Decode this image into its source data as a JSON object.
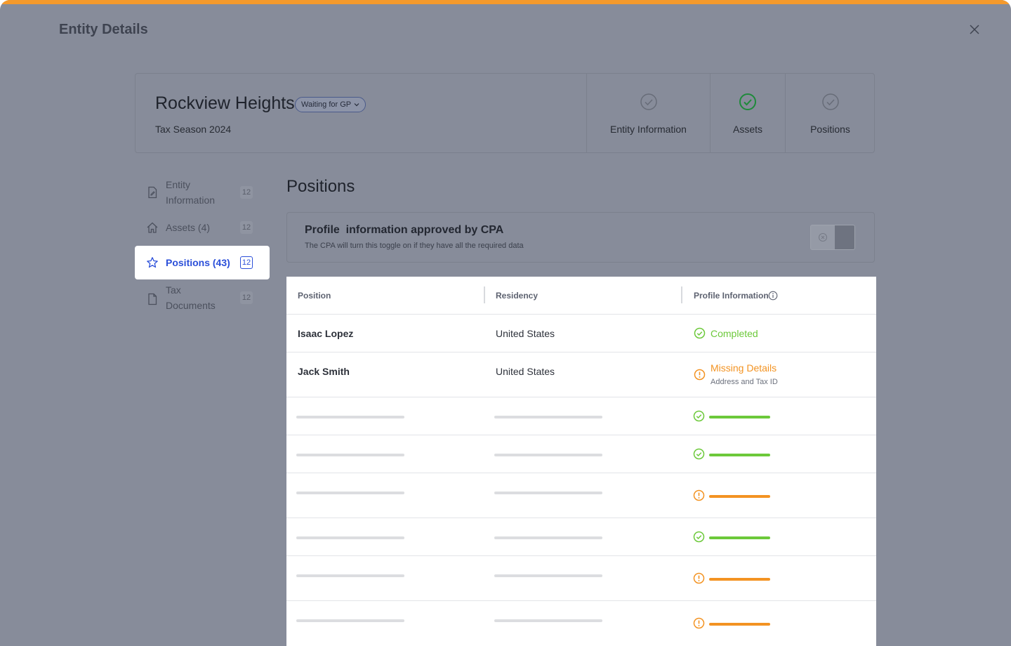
{
  "modal": {
    "title": "Entity Details"
  },
  "entity": {
    "name": "Rockview Heights",
    "status": "Waiting for GP",
    "subtitle": "Tax Season 2024"
  },
  "steps": [
    {
      "label": "Entity Information",
      "state": "pending",
      "icon": "check-circle-icon"
    },
    {
      "label": "Assets",
      "state": "done",
      "icon": "check-circle-icon"
    },
    {
      "label": "Positions",
      "state": "pending",
      "icon": "check-circle-icon"
    }
  ],
  "sidebar": {
    "items": [
      {
        "label": "Entity Information",
        "label_l1": "Entity",
        "label_l2": "Information",
        "count": "12",
        "icon": "document-edit-icon"
      },
      {
        "label": "Assets (4)",
        "count": "12",
        "icon": "home-icon"
      },
      {
        "label": "Positions (43)",
        "count": "12",
        "icon": "star-icon",
        "active": true
      },
      {
        "label": "Tax Documents",
        "label_l1": "Tax",
        "label_l2": "Documents",
        "count": "12",
        "icon": "file-icon"
      }
    ]
  },
  "main": {
    "title": "Positions",
    "approval": {
      "title": "Profile  information approved by CPA",
      "description": "The CPA will turn this toggle on if they have all the required data",
      "toggle_on": false
    },
    "table": {
      "columns": [
        "Position",
        "Residency",
        "Profile Information"
      ],
      "info_icon": "info-icon",
      "rows": [
        {
          "name": "Isaac Lopez",
          "residency": "United States",
          "status": "Completed",
          "state": "complete"
        },
        {
          "name": "Jack Smith",
          "residency": "United States",
          "status": "Missing Details",
          "detail": "Address and Tax ID",
          "state": "missing"
        }
      ],
      "placeholder_rows": [
        "complete",
        "complete",
        "missing",
        "complete",
        "missing",
        "missing"
      ]
    }
  },
  "colors": {
    "accent": "#f59a2c",
    "active_nav": "#2b4fd9",
    "complete": "#6cc93a",
    "missing": "#f39322",
    "step_done": "#1e8a3a"
  }
}
